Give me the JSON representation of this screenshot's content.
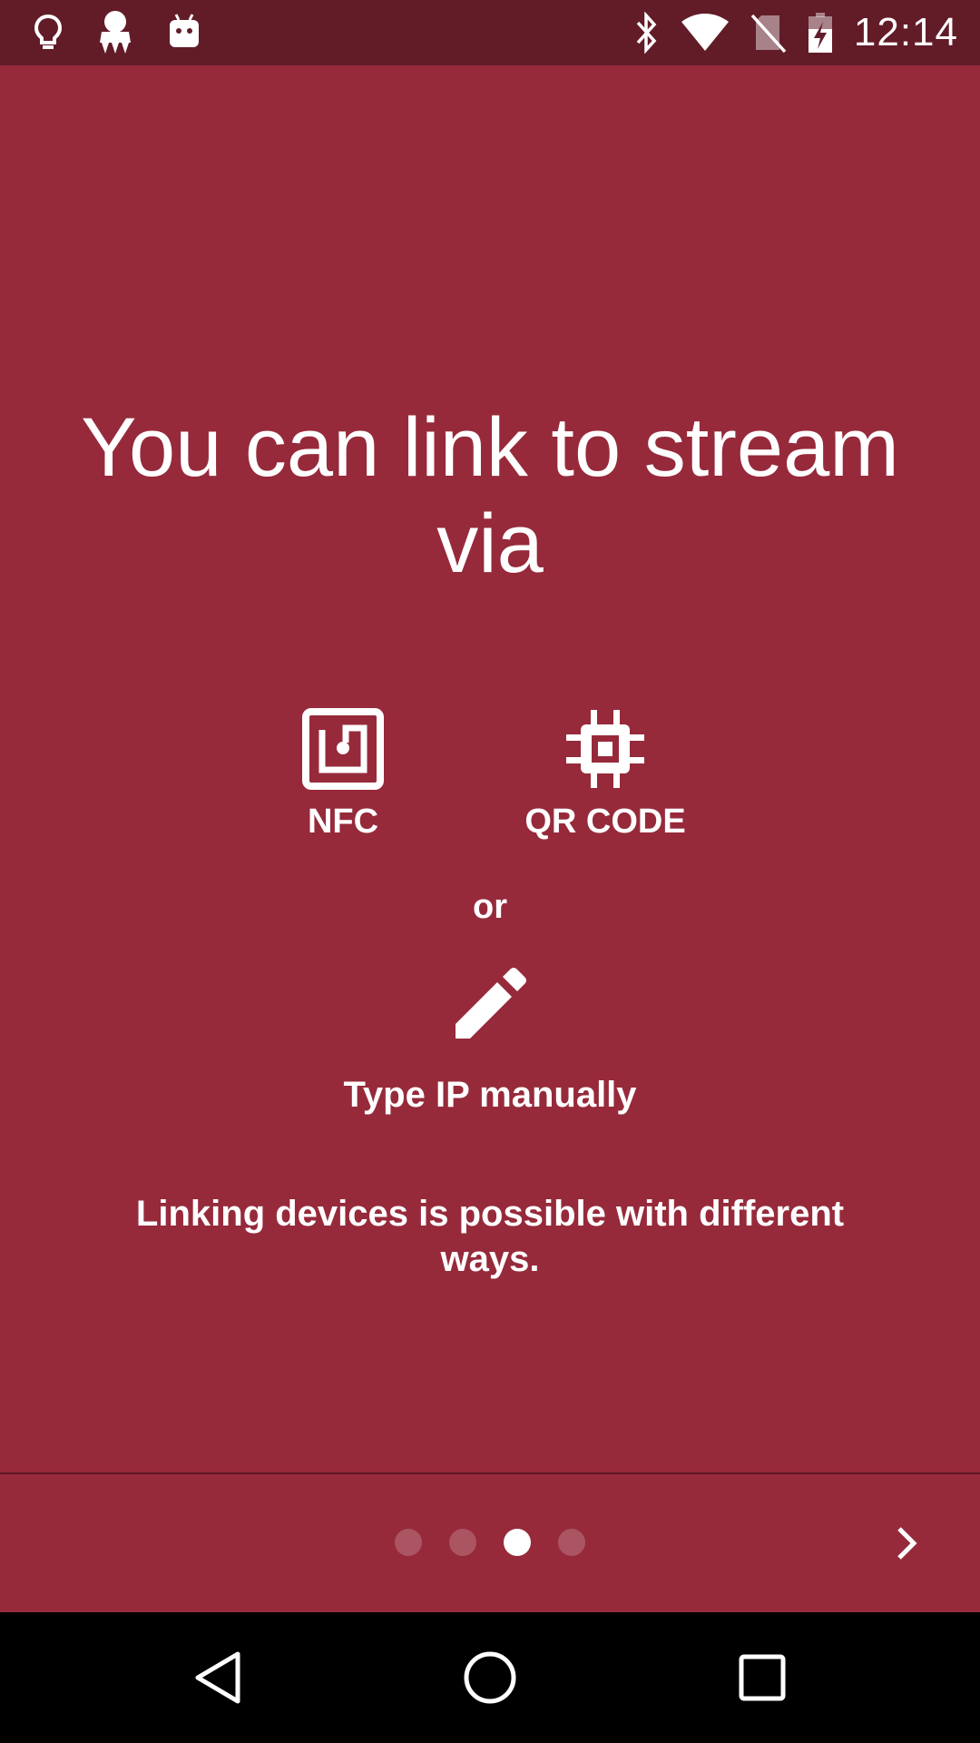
{
  "status_bar": {
    "time": "12:14",
    "left_icons": [
      "lightbulb-icon",
      "app-notification-icon",
      "android-debug-icon"
    ],
    "right_icons": [
      "bluetooth-icon",
      "wifi-icon",
      "no-sim-icon",
      "battery-charging-icon"
    ]
  },
  "main": {
    "headline": "You can link to stream via",
    "methods": [
      {
        "label": "NFC",
        "icon": "nfc-icon"
      },
      {
        "label": "QR CODE",
        "icon": "chip-icon"
      }
    ],
    "or_text": "or",
    "manual": {
      "label": "Type IP manually",
      "icon": "pencil-icon"
    },
    "description": "Linking devices is possible with different ways."
  },
  "pager": {
    "total": 4,
    "current": 3,
    "next_icon": "chevron-right-icon"
  },
  "nav_bar": {
    "buttons": [
      "back-icon",
      "home-icon",
      "recents-icon"
    ]
  },
  "colors": {
    "background": "#962a3b",
    "status_bar": "#621c28",
    "nav_bar": "#000000",
    "foreground": "#ffffff"
  }
}
